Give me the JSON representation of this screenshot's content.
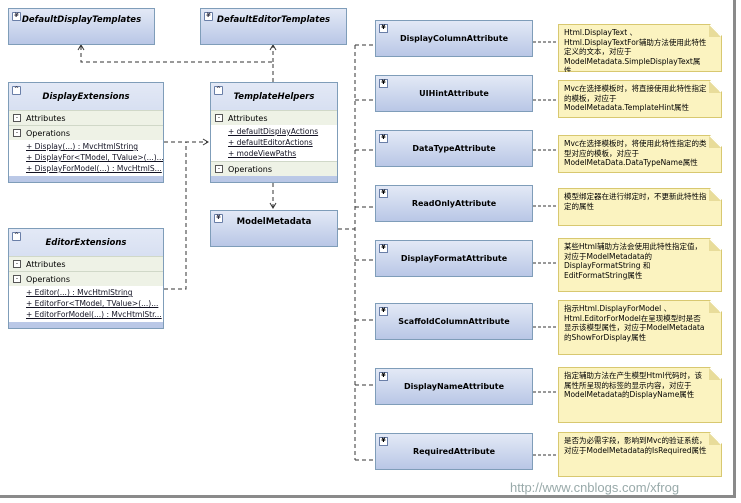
{
  "classes": {
    "default_display": {
      "name": "DefaultDisplayTemplates"
    },
    "default_editor": {
      "name": "DefaultEditorTemplates"
    },
    "display_ext": {
      "name": "DisplayExtensions",
      "attributes": "Attributes",
      "operations": "Operations",
      "ops": [
        "+ Display(...) : MvcHtmlString",
        "+ DisplayFor<TModel, TValue>(...)...",
        "+ DisplayForModel(...) : MvcHtmlS..."
      ]
    },
    "template_helpers": {
      "name": "TemplateHelpers",
      "attributes": "Attributes",
      "attrs": [
        "+ defaultDisplayActions",
        "+ defaultEditorActions",
        "+ modeViewPaths"
      ],
      "operations": "Operations"
    },
    "model_metadata": {
      "name": "ModelMetadata"
    },
    "editor_ext": {
      "name": "EditorExtensions",
      "attributes": "Attributes",
      "operations": "Operations",
      "ops": [
        "+ Editor(...) : MvcHtmlString",
        "+ EditorFor<TModel, TValue>(...)...",
        "+ EditorForModel(...) : MvcHtmlStr..."
      ]
    }
  },
  "attributes": [
    {
      "name": "DisplayColumnAttribute",
      "note": "Html.DisplayText 、Html.DisplayTextFor辅助方法使用此特性定义的文本，对应于ModelMetadata.SimpleDisplayText属性"
    },
    {
      "name": "UIHintAttribute",
      "note": "Mvc在选择模板时，将直接使用此特性指定的模板，对应于ModelMetadata.TemplateHint属性"
    },
    {
      "name": "DataTypeAttribute",
      "note": "Mvc在选择模板时，将使用此特性指定的类型对应的模板，对应于ModelMetaData.DataTypeName属性"
    },
    {
      "name": "ReadOnlyAttribute",
      "note": "模型绑定器在进行绑定时，不更新此特性指定的属性"
    },
    {
      "name": "DisplayFormatAttribute",
      "note": "某些Html辅助方法会使用此特性指定值，对应于ModelMetadata的DisplayFormatString 和EditFormatString属性"
    },
    {
      "name": "ScaffoldColumnAttribute",
      "note": "指示Html.DisplayForModel 、Html.EditorForModel在呈现模型时是否显示该模型属性，对应于ModelMetadata的ShowForDisplay属性"
    },
    {
      "name": "DisplayNameAttribute",
      "note": "指定辅助方法在产生模型Html代码时，该属性所呈现的标签的显示内容，对应于ModelMetadata的DisplayName属性"
    },
    {
      "name": "RequiredAttribute",
      "note": "是否为必需字段，影响到Mvc的验证系统，对应于ModelMetadata的IsRequired属性"
    }
  ],
  "watermark": "http://www.cnblogs.com/xfrog",
  "colors": {
    "class_fill": "#c8d4ee",
    "class_border": "#7f9db9",
    "note_fill": "#fbf3c0",
    "note_border": "#d8c870"
  }
}
